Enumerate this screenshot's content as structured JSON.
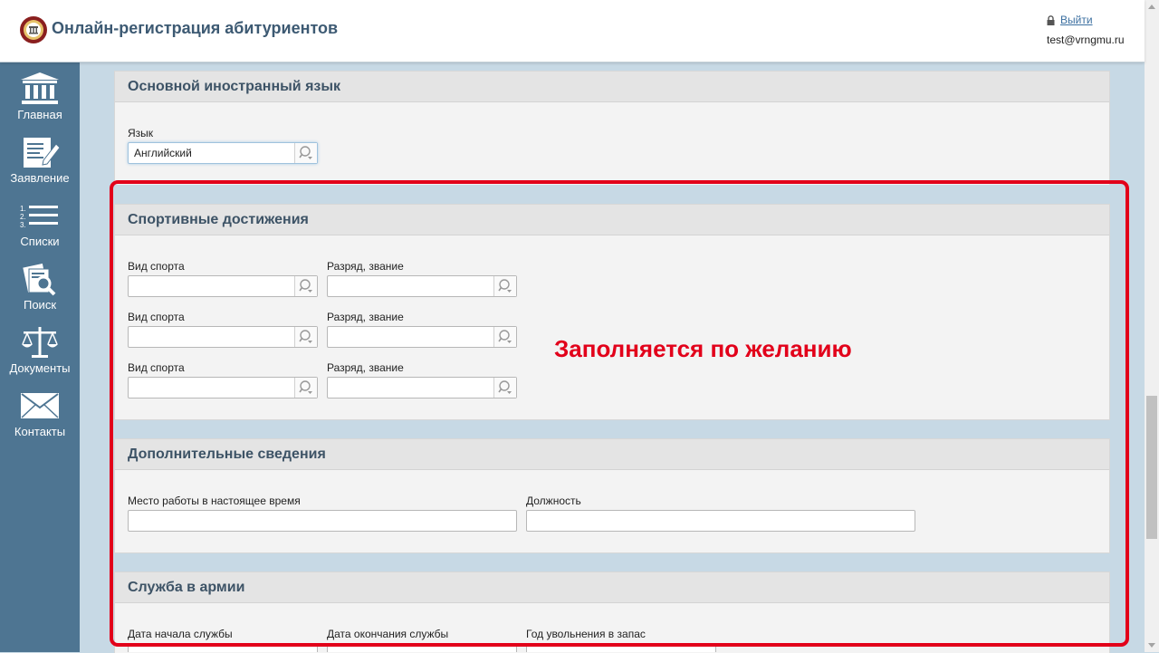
{
  "header": {
    "title": "Онлайн-регистрация абитуриентов",
    "logout_label": "Выйти",
    "user_email": "test@vrngmu.ru"
  },
  "sidebar": {
    "items": [
      {
        "label": "Главная",
        "icon": "columns-icon"
      },
      {
        "label": "Заявление",
        "icon": "edit-document-icon"
      },
      {
        "label": "Списки",
        "icon": "numbered-list-icon"
      },
      {
        "label": "Поиск",
        "icon": "search-document-icon"
      },
      {
        "label": "Документы",
        "icon": "scales-icon"
      },
      {
        "label": "Контакты",
        "icon": "envelope-icon"
      }
    ]
  },
  "language_section": {
    "title": "Основной иностранный язык",
    "label": "Язык",
    "value": "Английский"
  },
  "sports_section": {
    "title": "Спортивные достижения",
    "sport_label": "Вид спорта",
    "rank_label": "Разряд, звание"
  },
  "additional_section": {
    "title": "Дополнительные сведения",
    "workplace_label": "Место работы в настоящее время",
    "position_label": "Должность"
  },
  "army_section": {
    "title": "Служба в армии",
    "start_label": "Дата начала службы",
    "end_label": "Дата окончания службы",
    "reserve_label": "Год увольнения в запас"
  },
  "annotation": "Заполняется по желанию",
  "colors": {
    "sidebar": "#4e7592",
    "accent_red": "#e2001a",
    "title_blue": "#3d5a73",
    "background": "#c7d9e5"
  }
}
